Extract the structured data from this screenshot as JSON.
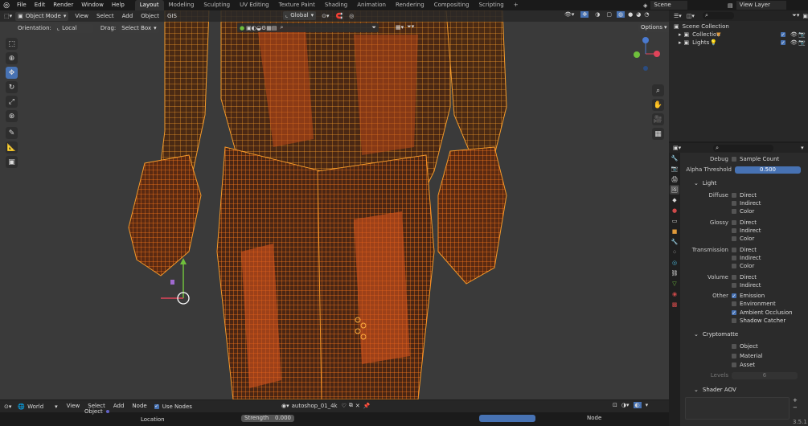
{
  "topbar": {
    "menus": [
      "File",
      "Edit",
      "Render",
      "Window",
      "Help"
    ],
    "workspaces": [
      "Layout",
      "Modeling",
      "Sculpting",
      "UV Editing",
      "Texture Paint",
      "Shading",
      "Animation",
      "Rendering",
      "Compositing",
      "Scripting"
    ],
    "active_workspace": "Layout",
    "add_tab": "+",
    "scene": "Scene",
    "view_layer": "View Layer"
  },
  "viewport_header": {
    "mode": "Object Mode",
    "menus": [
      "View",
      "Select",
      "Add",
      "Object",
      "GIS"
    ],
    "transform": "Global"
  },
  "tool_header": {
    "orientation_label": "Orientation:",
    "orientation_value": "Local",
    "drag_label": "Drag:",
    "drag_value": "Select Box",
    "options": "Options"
  },
  "outliner": {
    "root": "Scene Collection",
    "items": [
      {
        "name": "Collection"
      },
      {
        "name": "Lights"
      }
    ]
  },
  "properties": {
    "debug_label": "Debug",
    "sample_count": "Sample Count",
    "alpha_label": "Alpha Threshold",
    "alpha_value": "0.500",
    "light_panel": "Light",
    "diffuse": "Diffuse",
    "glossy": "Glossy",
    "transmission": "Transmission",
    "volume": "Volume",
    "other": "Other",
    "direct": "Direct",
    "indirect": "Indirect",
    "color": "Color",
    "emission": "Emission",
    "environment": "Environment",
    "ambient_occlusion": "Ambient Occlusion",
    "shadow_catcher": "Shadow Catcher",
    "crypto_panel": "Cryptomatte",
    "crypto_object": "Object",
    "crypto_material": "Material",
    "crypto_asset": "Asset",
    "levels_label": "Levels",
    "levels_value": "6",
    "shader_aov": "Shader AOV"
  },
  "bottom": {
    "world": "World",
    "menus": [
      "View",
      "Select",
      "Add",
      "Node"
    ],
    "use_nodes": "Use Nodes",
    "image_name": "autoshop_01_4k",
    "object_label": "Object",
    "location_label": "Location",
    "strength_label": "Strength",
    "strength_value": "0.000",
    "node_label": "Node",
    "version": "3.5.1"
  },
  "colors": {
    "accent": "#4772b3",
    "wire_orange": "#f08a1e",
    "wire_red": "#d9451a"
  }
}
